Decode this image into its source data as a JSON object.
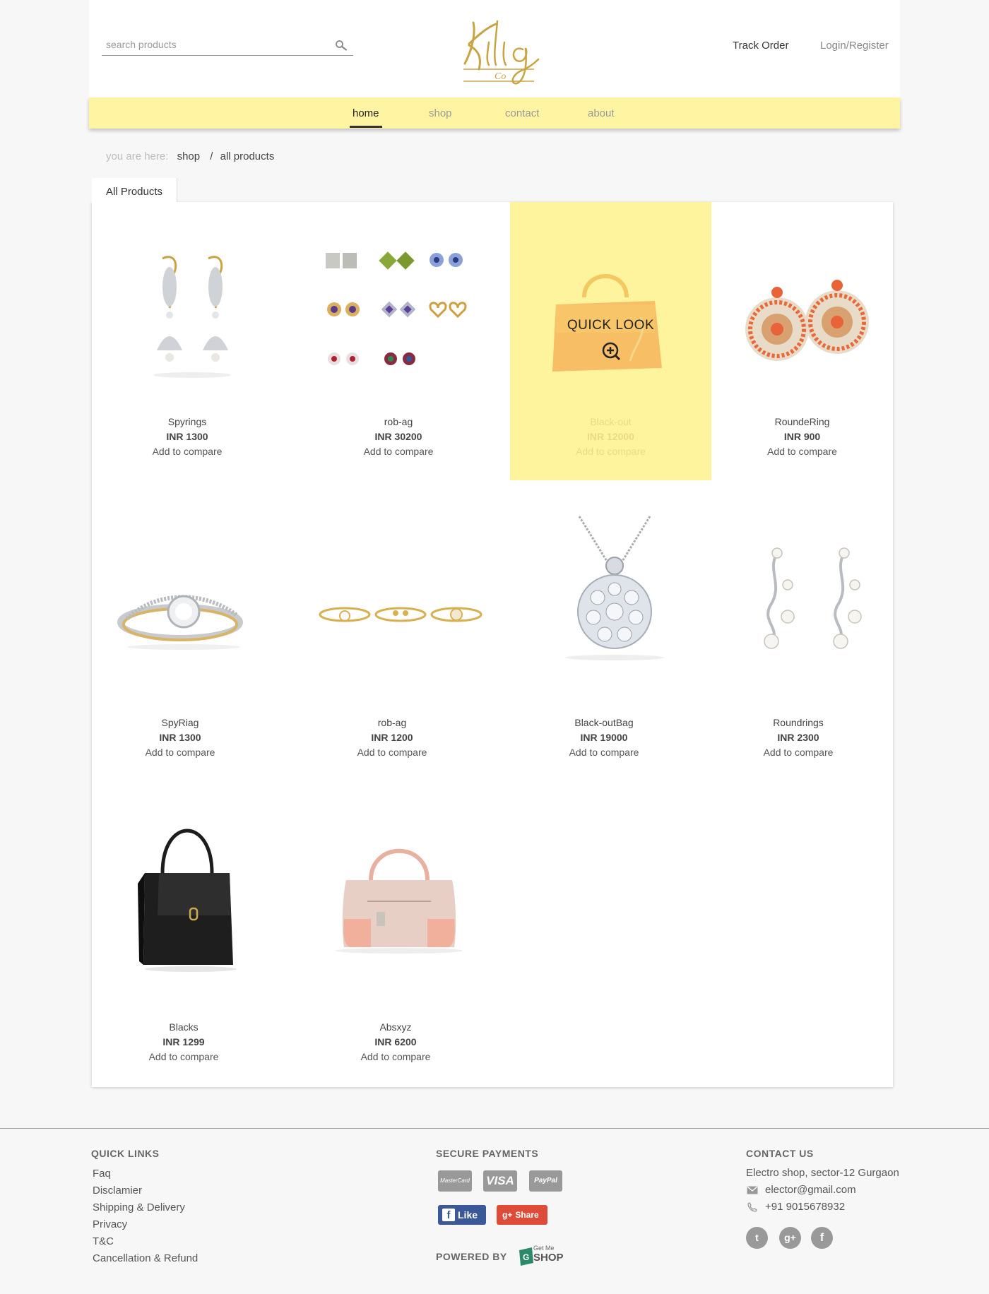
{
  "header": {
    "search_placeholder": "search products",
    "logo_text": "Kilig Co",
    "track_order": "Track Order",
    "login_register": "Login/Register"
  },
  "nav": {
    "items": [
      "home",
      "shop",
      "contact",
      "about"
    ],
    "active": "home"
  },
  "breadcrumb": {
    "prefix": "you are here:",
    "items": [
      "shop",
      "all products"
    ]
  },
  "tab_label": "All Products",
  "quick_look_label": "QUICK LOOK",
  "products": [
    {
      "name": "Spyrings",
      "price": "INR 1300",
      "compare": "Add to compare",
      "image": "peacock-jhumka-earrings"
    },
    {
      "name": "rob-ag",
      "price": "INR 30200",
      "compare": "Add to compare",
      "image": "stud-earrings-set"
    },
    {
      "name": "Black-out",
      "price": "INR 12000",
      "compare": "Add to compare",
      "image": "orange-handbag",
      "hovered": true
    },
    {
      "name": "RoundeRing",
      "price": "INR 900",
      "compare": "Add to compare",
      "image": "orange-round-earrings"
    },
    {
      "name": "SpyRiag",
      "price": "INR 1300",
      "compare": "Add to compare",
      "image": "diamond-ring"
    },
    {
      "name": "rob-ag",
      "price": "INR 1200",
      "compare": "Add to compare",
      "image": "gold-bracelets"
    },
    {
      "name": "Black-outBag",
      "price": "INR 19000",
      "compare": "Add to compare",
      "image": "diamond-pendant"
    },
    {
      "name": "Roundrings",
      "price": "INR 2300",
      "compare": "Add to compare",
      "image": "pearl-earrings"
    },
    {
      "name": "Blacks",
      "price": "INR 1299",
      "compare": "Add to compare",
      "image": "black-handbag"
    },
    {
      "name": "Absxyz",
      "price": "INR 6200",
      "compare": "Add to compare",
      "image": "pink-handbag"
    }
  ],
  "footer": {
    "quick_links_title": "QUICK LINKS",
    "quick_links": [
      "Faq",
      "Disclamier",
      "Shipping & Delivery",
      "Privacy",
      "T&C",
      "Cancellation & Refund"
    ],
    "payments_title": "SECURE PAYMENTS",
    "payment_methods": [
      "MasterCard",
      "VISA",
      "PayPal"
    ],
    "like_label": "Like",
    "share_label": "Share",
    "powered_by": "POWERED BY",
    "powered_logo_top": "Get Me",
    "powered_logo_bottom": "SHOP",
    "contact_title": "CONTACT US",
    "address": "Electro shop, sector-12 Gurgaon",
    "email": "elector@gmail.com",
    "phone": "+91 9015678932",
    "social": [
      "twitter",
      "google-plus",
      "facebook"
    ]
  },
  "colors": {
    "nav_bg": "#fff4a2",
    "hover_card_bg": "#fff49e",
    "facebook_blue": "#3b5998",
    "gplus_red": "#dd4b39",
    "logo_gold": "#c9a443"
  }
}
